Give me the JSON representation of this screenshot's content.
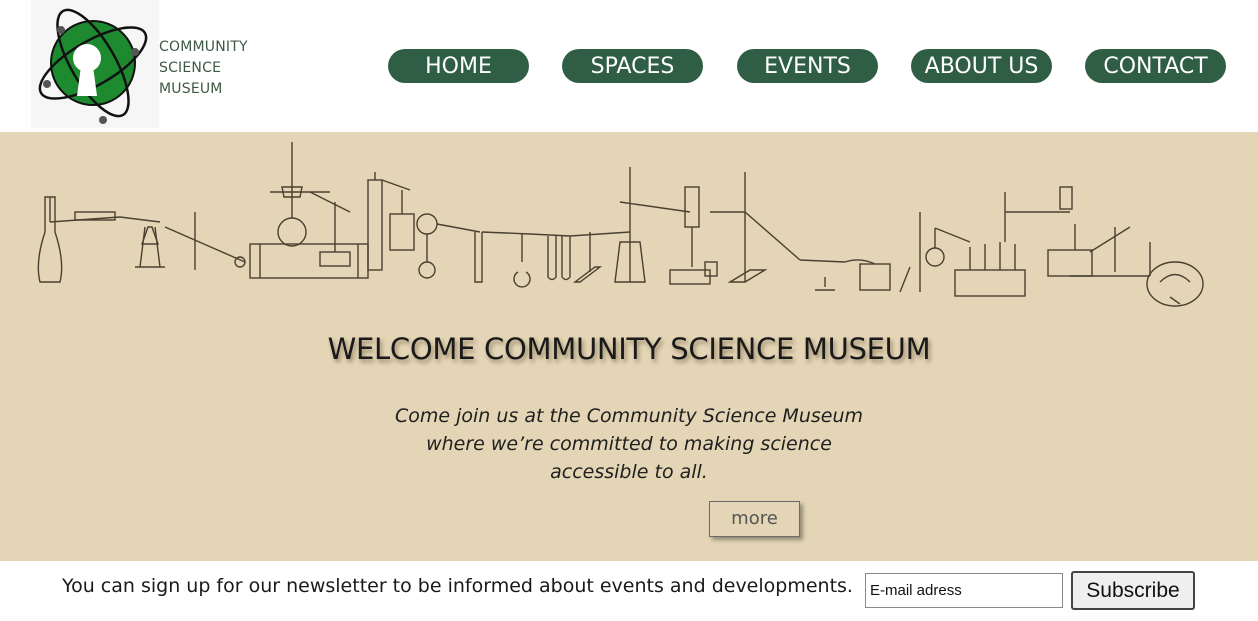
{
  "brand": {
    "name_lines": [
      "COMMUNITY",
      "SCIENCE",
      "MUSEUM"
    ],
    "logo_icon": "atom-keyhole-logo",
    "logo_color": "#1e8a30"
  },
  "nav": {
    "items": [
      {
        "label": "HOME"
      },
      {
        "label": "SPACES"
      },
      {
        "label": "EVENTS"
      },
      {
        "label": "ABOUT US"
      },
      {
        "label": "CONTACT"
      }
    ],
    "color": "#2f5e45"
  },
  "hero": {
    "banner_image": "laboratory-apparatus-illustration",
    "title": "WELCOME COMMUNITY SCIENCE MUSEUM",
    "subtitle": "Come join us at the Community Science Museum where we’re committed to making science accessible to all.",
    "more_label": "more",
    "background": "#e3d5b5"
  },
  "newsletter": {
    "text": "You can sign up for our newsletter to be informed about events and developments.",
    "email_placeholder": "E-mail adress",
    "subscribe_label": "Subscribe"
  }
}
